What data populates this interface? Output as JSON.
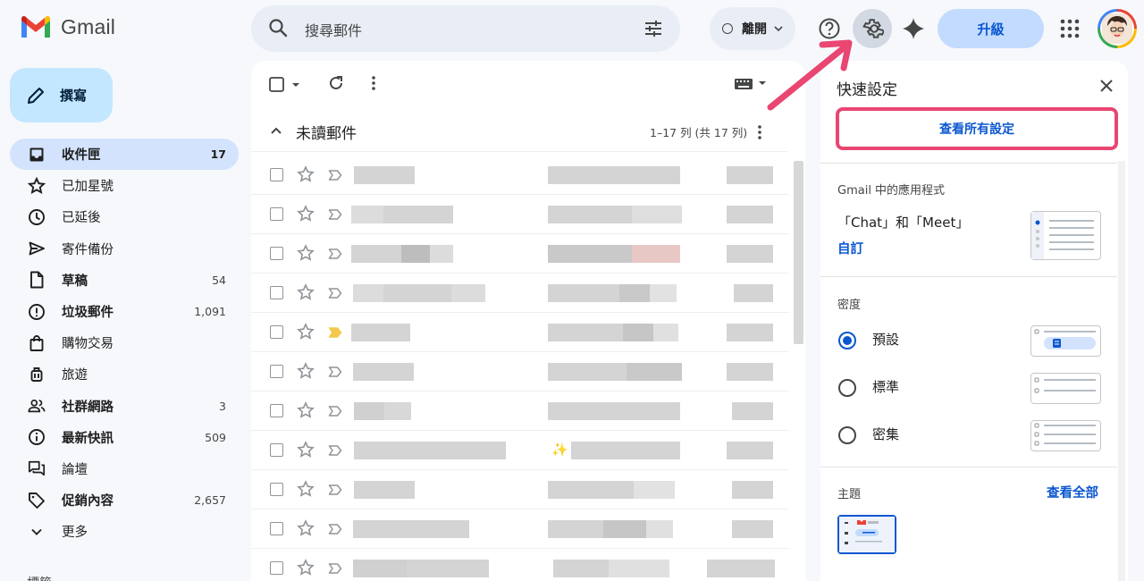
{
  "app": {
    "name": "Gmail"
  },
  "search": {
    "placeholder": "搜尋郵件"
  },
  "header": {
    "status_label": "離開",
    "upgrade_label": "升級"
  },
  "compose": {
    "label": "撰寫"
  },
  "nav": {
    "items": [
      {
        "label": "收件匣",
        "count": "17",
        "bold": true,
        "active": true,
        "icon": "inbox-icon"
      },
      {
        "label": "已加星號",
        "count": "",
        "bold": false,
        "icon": "star-icon"
      },
      {
        "label": "已延後",
        "count": "",
        "bold": false,
        "icon": "clock-icon"
      },
      {
        "label": "寄件備份",
        "count": "",
        "bold": false,
        "icon": "send-icon"
      },
      {
        "label": "草稿",
        "count": "54",
        "bold": true,
        "icon": "draft-icon"
      },
      {
        "label": "垃圾郵件",
        "count": "1,091",
        "bold": true,
        "icon": "spam-icon"
      },
      {
        "label": "購物交易",
        "count": "",
        "bold": false,
        "icon": "shopping-icon"
      },
      {
        "label": "旅遊",
        "count": "",
        "bold": false,
        "icon": "luggage-icon"
      },
      {
        "label": "社群網路",
        "count": "3",
        "bold": true,
        "icon": "people-icon"
      },
      {
        "label": "最新快訊",
        "count": "509",
        "bold": true,
        "icon": "info-icon"
      },
      {
        "label": "論壇",
        "count": "",
        "bold": false,
        "icon": "forum-icon"
      },
      {
        "label": "促銷內容",
        "count": "2,657",
        "bold": true,
        "icon": "tag-icon"
      },
      {
        "label": "更多",
        "count": "",
        "bold": false,
        "icon": "chevron-down-icon"
      }
    ],
    "partial_label": "標籤"
  },
  "mail": {
    "section_title": "未讀郵件",
    "range_label": "1–17 列 (共 17 列)",
    "rows": [
      {
        "important": false,
        "sparkle": false
      },
      {
        "important": false,
        "sparkle": false
      },
      {
        "important": false,
        "sparkle": false
      },
      {
        "important": false,
        "sparkle": false
      },
      {
        "important": true,
        "sparkle": false
      },
      {
        "important": false,
        "sparkle": false
      },
      {
        "important": false,
        "sparkle": false
      },
      {
        "important": false,
        "sparkle": true
      },
      {
        "important": false,
        "sparkle": false
      },
      {
        "important": false,
        "sparkle": false
      },
      {
        "important": false,
        "sparkle": false
      }
    ]
  },
  "quick_settings": {
    "title": "快速設定",
    "view_all_button": "查看所有設定",
    "apps_label": "Gmail 中的應用程式",
    "apps_text": "「Chat」和「Meet」",
    "apps_link": "自訂",
    "density_label": "密度",
    "density_options": [
      "預設",
      "標準",
      "密集"
    ],
    "density_selected": 0,
    "theme_label": "主題",
    "theme_link": "查看全部"
  },
  "colors": {
    "accent": "#0b57d0",
    "highlight": "#e94672",
    "compose": "#c2e7ff",
    "active_nav": "#d3e3fd"
  }
}
